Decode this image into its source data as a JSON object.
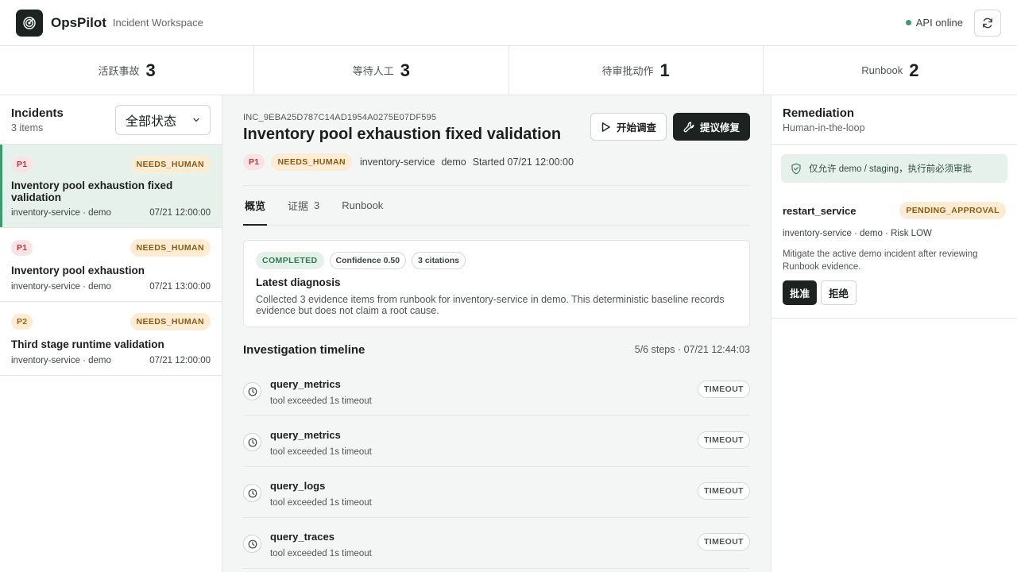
{
  "header": {
    "brand": "OpsPilot",
    "workspace": "Incident Workspace",
    "api_status": "API online",
    "api_status_color": "#3f9a6a",
    "logo_icon": "spiral-logo-icon",
    "refresh_icon": "refresh-icon"
  },
  "stats": [
    {
      "label": "活跃事故",
      "value": "3"
    },
    {
      "label": "等待人工",
      "value": "3"
    },
    {
      "label": "待审批动作",
      "value": "1"
    },
    {
      "label": "Runbook",
      "value": "2"
    }
  ],
  "incidents_panel": {
    "title": "Incidents",
    "count": "3 items",
    "filter_value": "全部状态",
    "items": [
      {
        "priority": "P1",
        "status": "NEEDS_HUMAN",
        "title": "Inventory pool exhaustion fixed validation",
        "meta": "inventory-service · demo",
        "time": "07/21 12:00:00"
      },
      {
        "priority": "P1",
        "status": "NEEDS_HUMAN",
        "title": "Inventory pool exhaustion",
        "meta": "inventory-service · demo",
        "time": "07/21 13:00:00"
      },
      {
        "priority": "P2",
        "status": "NEEDS_HUMAN",
        "title": "Third stage runtime validation",
        "meta": "inventory-service · demo",
        "time": "07/21 12:00:00"
      }
    ]
  },
  "detail": {
    "id": "INC_9EBA25D787C14AD1954A0275E07DF595",
    "title": "Inventory pool exhaustion fixed validation",
    "priority": "P1",
    "status": "NEEDS_HUMAN",
    "service": "inventory-service",
    "env": "demo",
    "started": "Started 07/21 12:00:00",
    "start_button": "开始调查",
    "suggest_button": "提议修复",
    "tabs": [
      {
        "label": "概览",
        "count": ""
      },
      {
        "label": "证据",
        "count": "3"
      },
      {
        "label": "Runbook",
        "count": ""
      }
    ],
    "diagnosis": {
      "state": "COMPLETED",
      "confidence": "Confidence 0.50",
      "citations": "3 citations",
      "title": "Latest diagnosis",
      "text": "Collected 3 evidence items from runbook for inventory-service in demo. This deterministic baseline records evidence but does not claim a root cause."
    },
    "timeline": {
      "title": "Investigation timeline",
      "meta": "5/6 steps · 07/21 12:44:03",
      "steps": [
        {
          "name": "query_metrics",
          "desc": "tool exceeded 1s timeout",
          "status": "TIMEOUT"
        },
        {
          "name": "query_metrics",
          "desc": "tool exceeded 1s timeout",
          "status": "TIMEOUT"
        },
        {
          "name": "query_logs",
          "desc": "tool exceeded 1s timeout",
          "status": "TIMEOUT"
        },
        {
          "name": "query_traces",
          "desc": "tool exceeded 1s timeout",
          "status": "TIMEOUT"
        }
      ]
    }
  },
  "remediation": {
    "title": "Remediation",
    "subtitle": "Human-in-the-loop",
    "notice": "仅允许 demo / staging，执行前必须审批",
    "action": {
      "name": "restart_service",
      "status": "PENDING_APPROVAL",
      "meta": "inventory-service · demo · Risk LOW",
      "desc": "Mitigate the active demo incident after reviewing Runbook evidence.",
      "approve": "批准",
      "reject": "拒绝"
    }
  }
}
